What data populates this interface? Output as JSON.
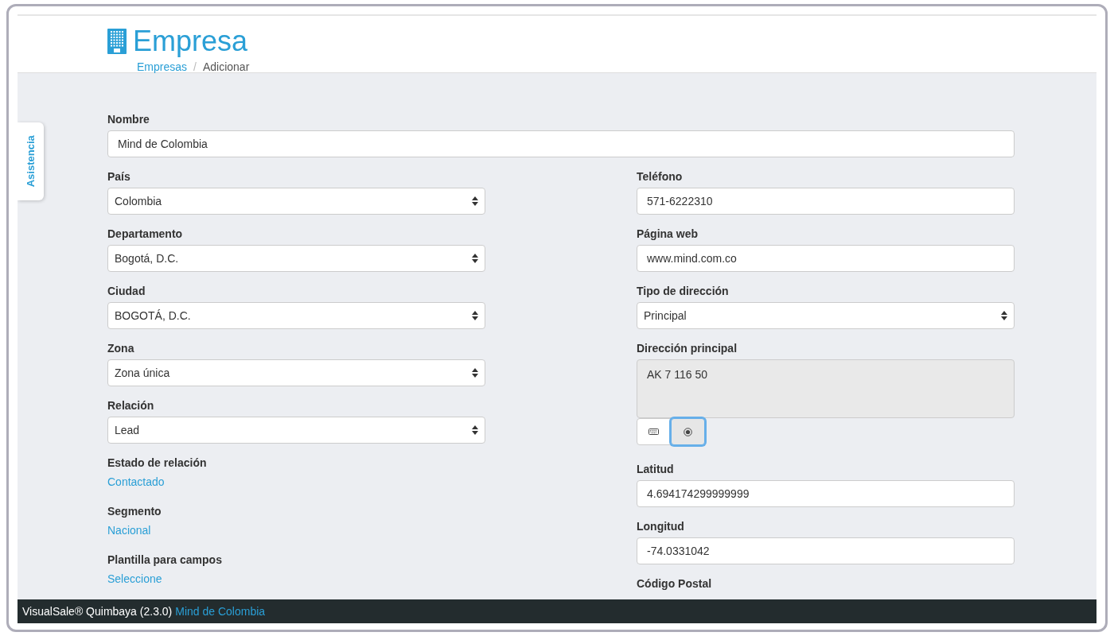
{
  "header": {
    "title": "Empresa",
    "breadcrumb": [
      {
        "label": "Empresas",
        "kind": "link"
      },
      {
        "label": "Adicionar",
        "kind": "current"
      }
    ],
    "separator": "/"
  },
  "side_tab": {
    "label": "Asistencia"
  },
  "form": {
    "full": [
      {
        "label": "Nombre",
        "kind": "text",
        "value": "Mind de Colombia"
      }
    ],
    "left": [
      {
        "label": "País",
        "kind": "select",
        "value": "Colombia"
      },
      {
        "label": "Departamento",
        "kind": "select",
        "value": "Bogotá, D.C."
      },
      {
        "label": "Ciudad",
        "kind": "select",
        "value": "BOGOTÁ, D.C."
      },
      {
        "label": "Zona",
        "kind": "select",
        "value": "Zona única"
      },
      {
        "label": "Relación",
        "kind": "select",
        "value": "Lead"
      },
      {
        "label": "Estado de relación",
        "kind": "link",
        "value": "Contactado"
      },
      {
        "label": "Segmento",
        "kind": "link",
        "value": "Nacional"
      },
      {
        "label": "Plantilla para campos",
        "kind": "link",
        "value": "Seleccione"
      }
    ],
    "right": [
      {
        "label": "Teléfono",
        "kind": "text",
        "value": "571-6222310"
      },
      {
        "label": "Página web",
        "kind": "text",
        "value": "www.mind.com.co"
      },
      {
        "label": "Tipo de dirección",
        "kind": "select",
        "value": "Principal"
      },
      {
        "label": "Dirección principal",
        "kind": "textarea",
        "value": "AK 7 116 50",
        "disabled": true,
        "buttons": [
          {
            "kind": "keyboard",
            "selected": false
          },
          {
            "kind": "target",
            "selected": true
          }
        ]
      },
      {
        "label": "Latitud",
        "kind": "text",
        "value": "4.694174299999999"
      },
      {
        "label": "Longitud",
        "kind": "text",
        "value": "-74.0331042"
      },
      {
        "label": "Código Postal",
        "kind": "label"
      }
    ]
  },
  "footer": {
    "product": "VisualSale® Quimbaya (2.3.0)",
    "company": "Mind de Colombia"
  }
}
